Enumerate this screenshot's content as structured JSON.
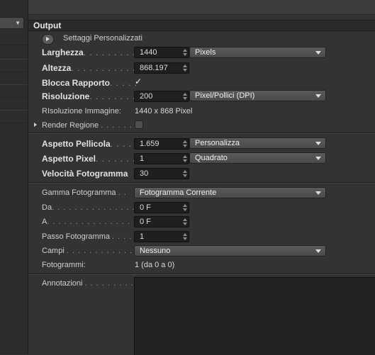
{
  "header": {
    "title": "Output"
  },
  "settings": {
    "label": "Settaggi  Personalizzati"
  },
  "rows": {
    "larghezza": {
      "label": "Larghezza",
      "dots": ". . . . . . . . . . .",
      "value": "1440",
      "unit": "Pixels"
    },
    "altezza": {
      "label": "Altezza",
      "dots": ". . . . . . . . . . . . .",
      "value": "868.197"
    },
    "blocca": {
      "label": "Blocca Rapporto",
      "dots": ". . . . .",
      "check": "✓"
    },
    "risoluzione": {
      "label": "Risoluzione",
      "dots": ". . . . . . . . .",
      "value": "200",
      "unit": "Pixel/Pollici (DPI)"
    },
    "risoluzione_immagine": {
      "label": "RIsoluzione Immagine:",
      "value": "1440 x 868 Pixel"
    },
    "render_regione": {
      "label": "Render Regione",
      "dots": ". . . . . . ."
    },
    "aspetto_pellicola": {
      "label": "Aspetto Pellicola",
      "dots": ". . . . .",
      "value": "1.659",
      "preset": "Personalizza"
    },
    "aspetto_pixel": {
      "label": "Aspetto Pixel",
      "dots": ". . . . . . . .",
      "value": "1",
      "preset": "Quadrato"
    },
    "velocita": {
      "label": "Velocità Fotogramma",
      "value": "30"
    },
    "gamma": {
      "label": "Gamma Fotogramma",
      "dots": ". .",
      "value": "Fotogramma Corrente"
    },
    "da": {
      "label": "Da",
      "dots": ". . . . . . . . . . . . . . . . . . .",
      "value": "0 F"
    },
    "a": {
      "label": "A",
      "dots": ". . . . . . . . . . . . . . . . . . . .",
      "value": "0 F"
    },
    "passo": {
      "label": "Passo Fotogramma",
      "dots": ". . . .",
      "value": "1"
    },
    "campi": {
      "label": "Campi",
      "dots": ". . . . . . . . . . . . . .",
      "value": "Nessuno"
    },
    "fotogrammi": {
      "label": "Fotogrammi:",
      "value": "1 (da 0 a 0)"
    },
    "annotazioni": {
      "label": "Annotazioni",
      "dots": ". . . . . . . . . ."
    }
  }
}
